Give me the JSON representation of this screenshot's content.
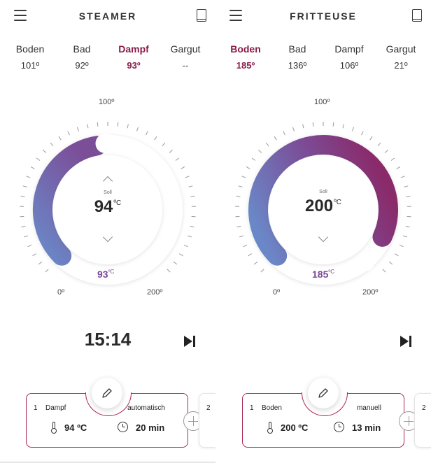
{
  "accent_color": "#8a1b48",
  "panels": [
    {
      "title": "STEAMER",
      "menu_icon": "menu-icon",
      "book_icon": "book-icon",
      "sensors": [
        {
          "label": "Boden",
          "value": "101º",
          "active": false
        },
        {
          "label": "Bad",
          "value": "92º",
          "active": false
        },
        {
          "label": "Dampf",
          "value": "93º",
          "active": true
        },
        {
          "label": "Gargut",
          "value": "--",
          "active": false
        }
      ],
      "dial": {
        "scale_min": "0º",
        "scale_mid": "100º",
        "scale_max": "200º",
        "soll_label": "Soll",
        "setpoint_value": "94",
        "setpoint_unit": "ºC",
        "actual_value": "93",
        "actual_unit": "ºC",
        "setpoint_numeric": 94,
        "actual_numeric": 93
      },
      "timer": "15:14",
      "card": {
        "number": "1",
        "phase": "Dampf",
        "mode": "automatisch",
        "temperature": "94 ºC",
        "duration": "20 min"
      },
      "next_card_number": "2"
    },
    {
      "title": "FRITTEUSE",
      "menu_icon": "menu-icon",
      "book_icon": "book-icon",
      "sensors": [
        {
          "label": "Boden",
          "value": "185º",
          "active": true
        },
        {
          "label": "Bad",
          "value": "136º",
          "active": false
        },
        {
          "label": "Dampf",
          "value": "106º",
          "active": false
        },
        {
          "label": "Gargut",
          "value": "21º",
          "active": false
        }
      ],
      "dial": {
        "scale_min": "0º",
        "scale_mid": "100º",
        "scale_max": "200º",
        "soll_label": "Soll",
        "setpoint_value": "200",
        "setpoint_unit": "ºC",
        "actual_value": "185",
        "actual_unit": "ºC",
        "setpoint_numeric": 200,
        "actual_numeric": 185
      },
      "timer": "",
      "card": {
        "number": "1",
        "phase": "Boden",
        "mode": "manuell",
        "temperature": "200 ºC",
        "duration": "13 min"
      },
      "next_card_number": "2"
    }
  ]
}
